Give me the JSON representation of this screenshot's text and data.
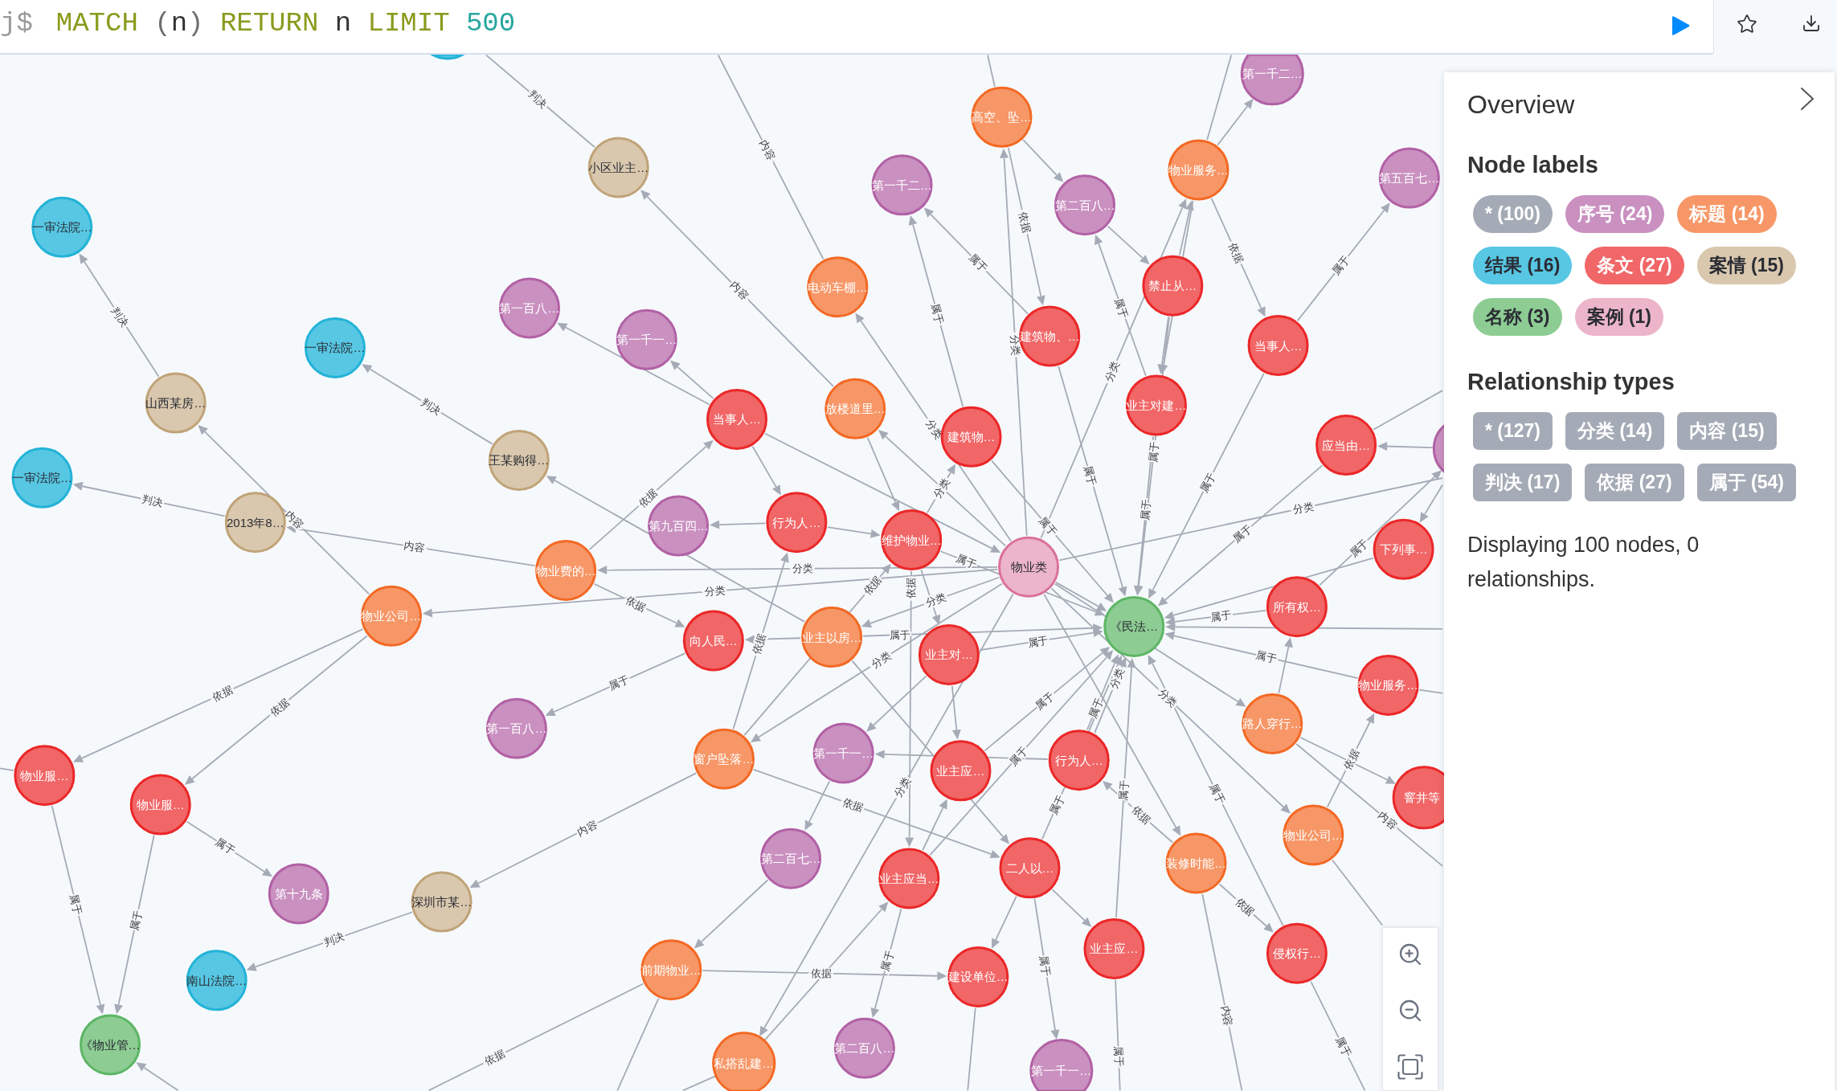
{
  "editor": {
    "prompt": "j$",
    "query": [
      {
        "tokens": [
          {
            "text": "MATCH",
            "kind": "keyword"
          }
        ]
      },
      {
        "tokens": [
          {
            "text": "(",
            "kind": "punctuation"
          },
          {
            "text": "n",
            "kind": "variable"
          },
          {
            "text": ")",
            "kind": "punctuation"
          }
        ]
      },
      {
        "tokens": [
          {
            "text": "RETURN",
            "kind": "keyword"
          }
        ]
      },
      {
        "tokens": [
          {
            "text": "n",
            "kind": "variable"
          }
        ]
      },
      {
        "tokens": [
          {
            "text": "LIMIT",
            "kind": "keyword"
          }
        ]
      },
      {
        "tokens": [
          {
            "text": "500",
            "kind": "number"
          }
        ]
      }
    ]
  },
  "graph": {
    "nodes": [
      {
        "caption": "一审法院…",
        "color": "#57c7e3"
      },
      {
        "caption": "小区业主…",
        "color": "#d9c8ae"
      },
      {
        "caption": "第一千二…",
        "color": "#c990c0"
      },
      {
        "caption": "高空、坠…",
        "color": "#f79767"
      },
      {
        "caption": "第一千二…",
        "color": "#c990c0"
      },
      {
        "caption": "第二百八…",
        "color": "#c990c0"
      },
      {
        "caption": "物业服务…",
        "color": "#f79767"
      },
      {
        "caption": "第五百七…",
        "color": "#c990c0"
      },
      {
        "caption": "第一百八…",
        "color": "#c990c0"
      },
      {
        "caption": "第一千一…",
        "color": "#c990c0"
      },
      {
        "caption": "电动车棚…",
        "color": "#f79767"
      },
      {
        "caption": "一审法院…",
        "color": "#57c7e3"
      },
      {
        "caption": "建筑物、…",
        "color": "#f16667"
      },
      {
        "caption": "禁止从…",
        "color": "#f16667"
      },
      {
        "caption": "当事人…",
        "color": "#f16667"
      },
      {
        "caption": "山西某房…",
        "color": "#d9c8ae"
      },
      {
        "caption": "当事人…",
        "color": "#f16667"
      },
      {
        "caption": "放楼道里…",
        "color": "#f79767"
      },
      {
        "caption": "建筑物…",
        "color": "#f16667"
      },
      {
        "caption": "业主对建…",
        "color": "#f16667"
      },
      {
        "caption": "应当由…",
        "color": "#f16667"
      },
      {
        "caption": "一审法院…",
        "color": "#57c7e3"
      },
      {
        "caption": "王某购得…",
        "color": "#d9c8ae"
      },
      {
        "caption": "2013年8…",
        "color": "#d9c8ae"
      },
      {
        "caption": "第九百四…",
        "color": "#c990c0"
      },
      {
        "caption": "行为人…",
        "color": "#f16667"
      },
      {
        "caption": "维护物业…",
        "color": "#f16667"
      },
      {
        "caption": "物业类",
        "color": "#ecb5c9"
      },
      {
        "caption": "下列事…",
        "color": "#f16667"
      },
      {
        "caption": "物业费的…",
        "color": "#f79767"
      },
      {
        "caption": "物业公司…",
        "color": "#f79767"
      },
      {
        "caption": "向人民…",
        "color": "#f16667"
      },
      {
        "caption": "业主以房…",
        "color": "#f79767"
      },
      {
        "caption": "业主对…",
        "color": "#f16667"
      },
      {
        "caption": "《民法…",
        "color": "#8dcc93"
      },
      {
        "caption": "所有权…",
        "color": "#f16667"
      },
      {
        "caption": "物业服务…",
        "color": "#f16667"
      },
      {
        "caption": "第一百八…",
        "color": "#c990c0"
      },
      {
        "caption": "窗户坠落…",
        "color": "#f79767"
      },
      {
        "caption": "第一千一…",
        "color": "#c990c0"
      },
      {
        "caption": "业主应…",
        "color": "#f16667"
      },
      {
        "caption": "行为人…",
        "color": "#f16667"
      },
      {
        "caption": "路人穿行…",
        "color": "#f79767"
      },
      {
        "caption": "窨井等",
        "color": "#f16667"
      },
      {
        "caption": "物业服…",
        "color": "#f16667"
      },
      {
        "caption": "物业服…",
        "color": "#f16667"
      },
      {
        "caption": "第十九条",
        "color": "#c990c0"
      },
      {
        "caption": "深圳市某…",
        "color": "#d9c8ae"
      },
      {
        "caption": "第二百七…",
        "color": "#c990c0"
      },
      {
        "caption": "业主应当…",
        "color": "#f16667"
      },
      {
        "caption": "二人以…",
        "color": "#f16667"
      },
      {
        "caption": "装修时能…",
        "color": "#f79767"
      },
      {
        "caption": "物业公司…",
        "color": "#f79767"
      },
      {
        "caption": "南山法院…",
        "color": "#57c7e3"
      },
      {
        "caption": "前期物业…",
        "color": "#f79767"
      },
      {
        "caption": "建设单位…",
        "color": "#f16667"
      },
      {
        "caption": "业主应…",
        "color": "#f16667"
      },
      {
        "caption": "侵权行…",
        "color": "#f16667"
      },
      {
        "caption": "《物业管…",
        "color": "#8dcc93"
      },
      {
        "caption": "私搭乱建…",
        "color": "#f79767"
      },
      {
        "caption": "第二百八…",
        "color": "#c990c0"
      },
      {
        "caption": "第一千一…",
        "color": "#c990c0"
      },
      {
        "color": "#c990c0"
      },
      {
        "color": "#57c7e3"
      }
    ],
    "relationships": [
      "判决",
      "内容",
      "内容",
      "判决",
      "判决",
      "判决",
      "内容",
      "内容",
      "依据",
      "分类",
      "分类",
      "依据",
      "依据",
      "依据",
      "属于",
      "属于",
      "属于",
      "属于",
      "内容",
      "判决",
      "依据",
      "依据",
      "分类",
      "依据",
      "属于",
      "属于",
      "属于",
      "属于",
      "内容",
      "依据",
      "依据",
      "依据",
      "内容",
      "属于",
      "属于",
      "属于",
      "属于",
      "属于",
      "属于",
      "属于",
      "属于",
      "属于",
      "属于",
      "属于",
      "属于",
      "属于",
      "属于",
      "属于",
      "属于",
      "属于",
      "分类",
      "分类",
      "分类",
      "属于",
      "依据",
      "属于",
      "属于",
      "分类",
      "属于",
      "分类",
      "依据",
      "属于",
      "分类",
      "分类",
      "依据",
      "依据",
      "依据",
      "分类",
      "分类"
    ]
  },
  "overview": {
    "title": "Overview",
    "node_labels_heading": "Node labels",
    "node_labels": [
      {
        "text": "* (100)",
        "color": "#a5abb6"
      },
      {
        "text": "序号 (24)",
        "color": "#c990c0"
      },
      {
        "text": "标题 (14)",
        "color": "#f79767"
      },
      {
        "text": "结果 (16)",
        "color": "#57c7e3"
      },
      {
        "text": "条文 (27)",
        "color": "#f16667"
      },
      {
        "text": "案情 (15)",
        "color": "#d9c8ae"
      },
      {
        "text": "名称 (3)",
        "color": "#8dcc93"
      },
      {
        "text": "案例 (1)",
        "color": "#ecb5c9"
      }
    ],
    "relationship_types_heading": "Relationship types",
    "relationship_types": [
      "* (127)",
      "分类 (14)",
      "内容 (15)",
      "判决 (17)",
      "依据 (27)",
      "属于 (54)"
    ],
    "status": "Displaying 100 nodes, 0 relationships."
  }
}
